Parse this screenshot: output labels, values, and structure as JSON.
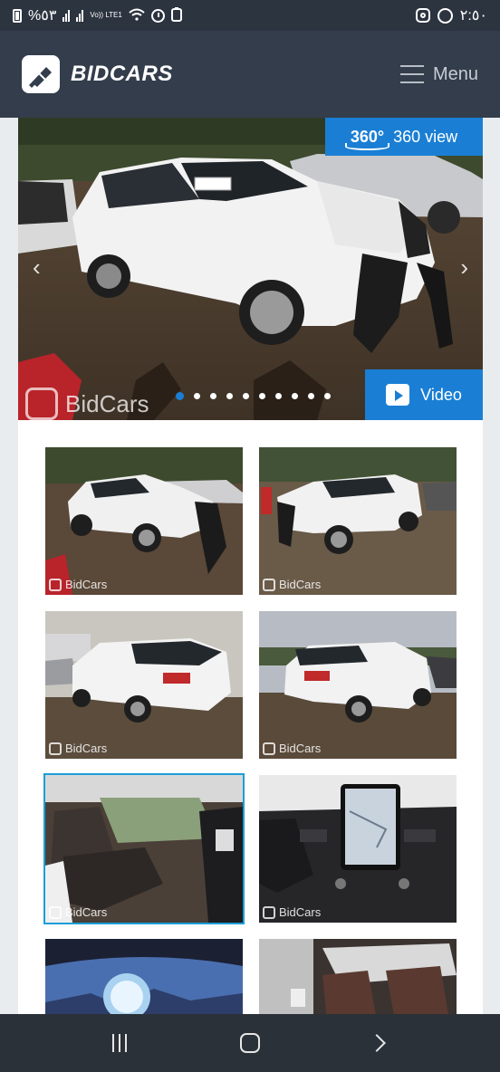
{
  "status_bar": {
    "battery_text": "%٥٣",
    "volte_text": "Vo)) LTE1",
    "time": "٢:٥٠"
  },
  "header": {
    "brand": "BIDCARS",
    "menu_label": "Menu"
  },
  "gallery": {
    "view360_deg": "360°",
    "view360_label": "360 view",
    "video_label": "Video",
    "watermark": "BidCars",
    "slide_count": 10,
    "active_slide": 0,
    "thumbnails": [
      {
        "watermark": "BidCars",
        "selected": false
      },
      {
        "watermark": "BidCars",
        "selected": false
      },
      {
        "watermark": "BidCars",
        "selected": false
      },
      {
        "watermark": "BidCars",
        "selected": false
      },
      {
        "watermark": "BidCars",
        "selected": true
      },
      {
        "watermark": "BidCars",
        "selected": false
      },
      {
        "watermark": "",
        "selected": false
      },
      {
        "watermark": "",
        "selected": false
      }
    ]
  },
  "icons": {
    "menu": "hamburger-icon",
    "prev": "chevron-left-icon",
    "next": "chevron-right-icon",
    "video": "play-video-icon",
    "view360": "rotate-360-icon"
  },
  "colors": {
    "header_bg": "#333d4b",
    "accent": "#1a7fd4",
    "selected_outline": "#1a9fd8"
  }
}
